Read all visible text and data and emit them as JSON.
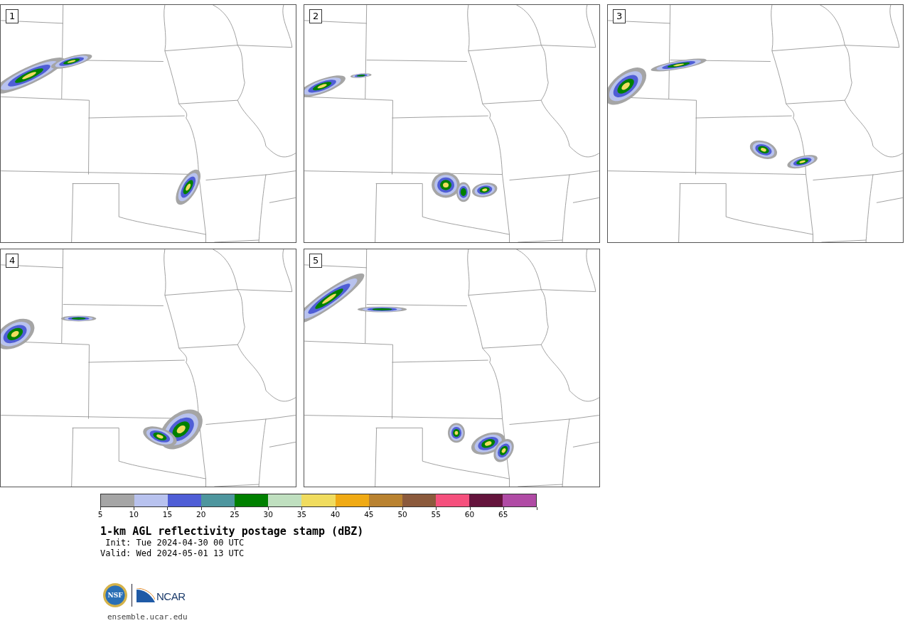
{
  "panels": [
    {
      "number": "1"
    },
    {
      "number": "2"
    },
    {
      "number": "3"
    },
    {
      "number": "4"
    },
    {
      "number": "5"
    }
  ],
  "legend": {
    "segments": [
      {
        "color": "#a5a5a5"
      },
      {
        "color": "#b8c2ee"
      },
      {
        "color": "#4f5ed6"
      },
      {
        "color": "#4e969e"
      },
      {
        "color": "#008000"
      },
      {
        "color": "#bfdfbf"
      },
      {
        "color": "#f0dc5f"
      },
      {
        "color": "#f0aa14"
      },
      {
        "color": "#b98230"
      },
      {
        "color": "#8b5a3c"
      },
      {
        "color": "#f5507d"
      },
      {
        "color": "#64143c"
      },
      {
        "color": "#b04ba5"
      }
    ],
    "ticks": [
      "5",
      "10",
      "15",
      "20",
      "25",
      "30",
      "35",
      "40",
      "45",
      "50",
      "55",
      "60",
      "65"
    ]
  },
  "caption": {
    "title": "1-km AGL reflectivity postage stamp (dBZ)",
    "init": " Init: Tue 2024-04-30 00 UTC",
    "valid": "Valid: Wed 2024-05-01 13 UTC"
  },
  "logos": {
    "nsf": "NSF",
    "ncar": "NCAR",
    "url": "ensemble.ucar.edu"
  }
}
